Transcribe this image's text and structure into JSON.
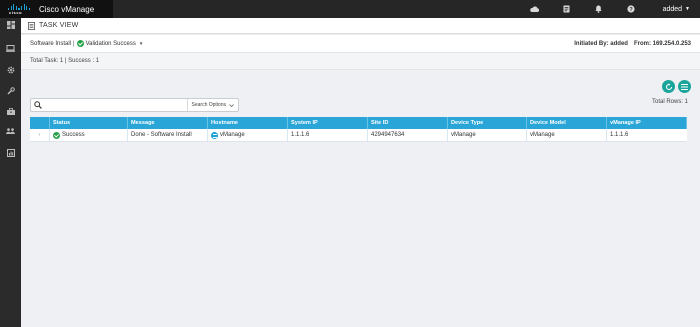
{
  "header": {
    "brand_logo_text": "cisco",
    "app_name": "Cisco vManage",
    "user": "added",
    "icons": [
      "cloud-icon",
      "task-list-icon",
      "bell-icon",
      "help-icon"
    ]
  },
  "sidebar": {
    "items": [
      {
        "icon": "dashboard-icon"
      },
      {
        "icon": "monitor-icon"
      },
      {
        "icon": "gear-icon"
      },
      {
        "icon": "wrench-icon"
      },
      {
        "icon": "toolbox-icon"
      },
      {
        "icon": "users-icon"
      },
      {
        "icon": "analytics-icon"
      }
    ]
  },
  "page": {
    "title": "TASK VIEW"
  },
  "summary": {
    "task_name": "Software Install",
    "separator": "|",
    "status": "Validation Success",
    "initiated_label": "Initiated By:",
    "initiated_by": "added",
    "from_label": "From:",
    "from_ip": "169.254.0.253",
    "totals": "Total Task: 1 | Success : 1"
  },
  "search": {
    "placeholder": "",
    "value": "",
    "options_label": "Search Options"
  },
  "table": {
    "total_rows_label": "Total Rows: 1",
    "columns": [
      "Status",
      "Message",
      "Hostname",
      "System IP",
      "Site ID",
      "Device Type",
      "Device Model",
      "vManage IP"
    ],
    "rows": [
      {
        "status": "Success",
        "message": "Done - Software Install",
        "hostname": "vManage",
        "system_ip": "1.1.1.6",
        "site_id": "4294947634",
        "device_type": "vManage",
        "device_model": "vManage",
        "vmanage_ip": "1.1.1.6"
      }
    ]
  },
  "colors": {
    "topbar": "#262626",
    "sidebar": "#2b2b2b",
    "table_header": "#29a5d8",
    "action_button": "#1aa59b",
    "success": "#24a148"
  }
}
